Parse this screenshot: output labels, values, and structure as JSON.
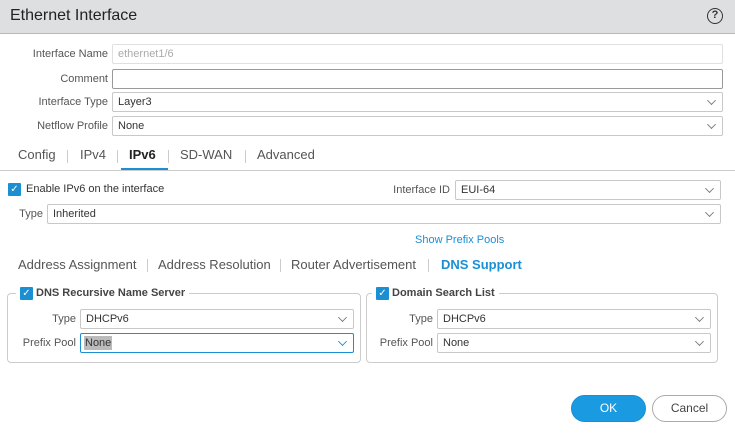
{
  "header": {
    "title": "Ethernet Interface",
    "help_icon": "help-icon"
  },
  "form": {
    "interface_name": {
      "label": "Interface Name",
      "value": "ethernet1/6"
    },
    "comment": {
      "label": "Comment",
      "value": ""
    },
    "interface_type": {
      "label": "Interface Type",
      "value": "Layer3"
    },
    "netflow_profile": {
      "label": "Netflow Profile",
      "value": "None"
    }
  },
  "tabs": [
    "Config",
    "IPv4",
    "IPv6",
    "SD-WAN",
    "Advanced"
  ],
  "active_tab": "IPv6",
  "ipv6": {
    "enable_label": "Enable IPv6 on the interface",
    "enabled": true,
    "interface_id": {
      "label": "Interface ID",
      "value": "EUI-64"
    },
    "type": {
      "label": "Type",
      "value": "Inherited"
    },
    "show_prefix_pools": "Show Prefix Pools",
    "subtabs": [
      "Address Assignment",
      "Address Resolution",
      "Router Advertisement",
      "DNS Support"
    ],
    "active_subtab": "DNS Support",
    "dns_server": {
      "label": "DNS Recursive Name Server",
      "checked": true,
      "type_label": "Type",
      "type": "DHCPv6",
      "pool_label": "Prefix Pool",
      "pool": "None"
    },
    "domain_search": {
      "label": "Domain Search List",
      "checked": true,
      "type_label": "Type",
      "type": "DHCPv6",
      "pool_label": "Prefix Pool",
      "pool": "None"
    }
  },
  "buttons": {
    "ok": "OK",
    "cancel": "Cancel"
  },
  "colors": {
    "accent": "#1a8fd4"
  }
}
